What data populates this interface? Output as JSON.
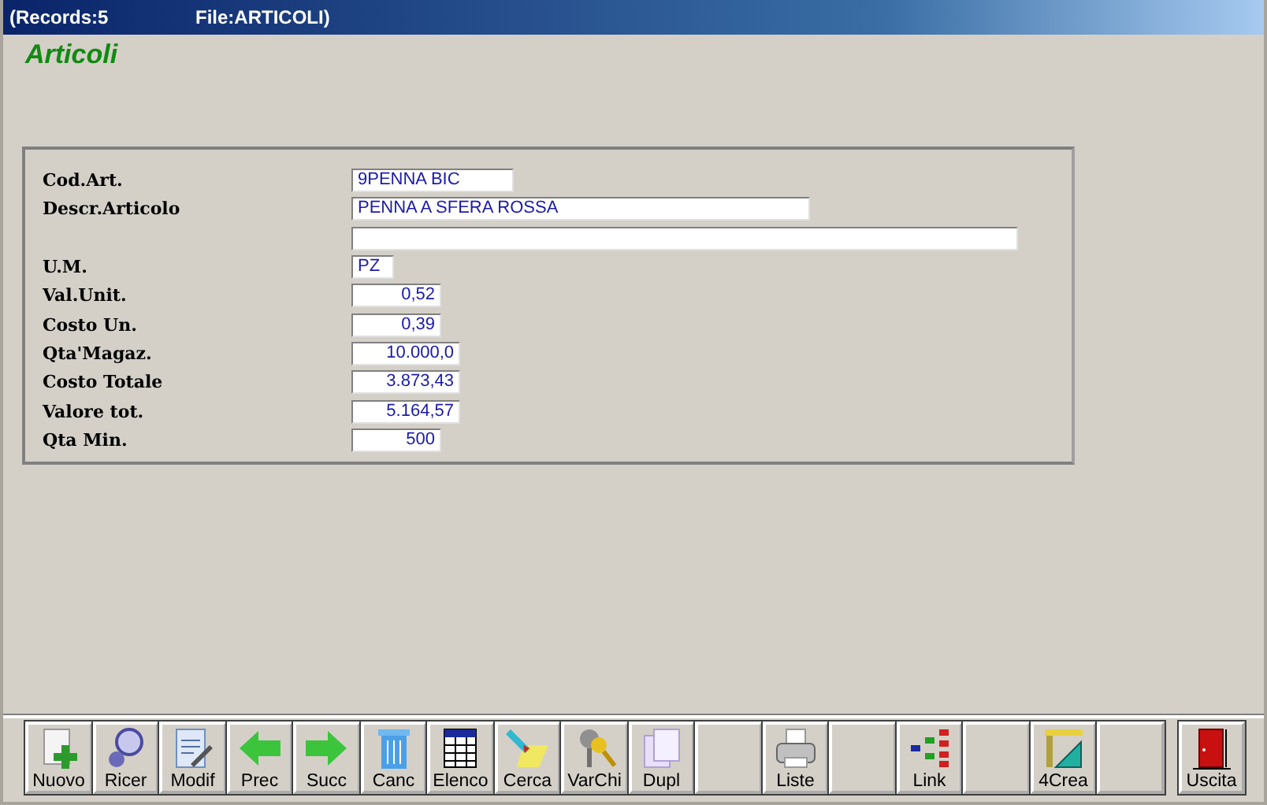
{
  "window": {
    "title": "(Records:5",
    "file": "File:ARTICOLI)"
  },
  "heading": "Articoli",
  "fields": [
    {
      "label": "Cod.Art.",
      "value": "9PENNA BIC",
      "kind": "text"
    },
    {
      "label": "Descr.Articolo",
      "value": "PENNA A SFERA ROSSA",
      "kind": "text"
    },
    {
      "kind": "text"
    },
    {
      "label": "U.M.",
      "value": "PZ",
      "kind": "text"
    },
    {
      "label": "Val.Unit.",
      "value": "0,52",
      "kind": "number"
    },
    {
      "label": "Costo Un.",
      "value": "0,39",
      "kind": "number"
    },
    {
      "label": "Qta'Magaz.",
      "value": "10.000,0",
      "kind": "number"
    },
    {
      "label": "Costo Totale",
      "value": "3.873,43",
      "kind": "number"
    },
    {
      "label": "Valore tot.",
      "value": "5.164,57",
      "kind": "number"
    },
    {
      "label": "Qta Min.",
      "value": "500",
      "kind": "number"
    }
  ],
  "toolbar": [
    {
      "label": "Nuovo",
      "kind": "new"
    },
    {
      "label": "Ricer",
      "kind": "find"
    },
    {
      "label": "Modif",
      "kind": "edit"
    },
    {
      "label": "Prec",
      "kind": "prev"
    },
    {
      "label": "Succ",
      "kind": "next"
    },
    {
      "label": "Canc",
      "kind": "trash"
    },
    {
      "label": "Elenco",
      "kind": "table"
    },
    {
      "label": "Cerca",
      "kind": "marker"
    },
    {
      "label": "VarChi",
      "kind": "keys"
    },
    {
      "label": "Dupl",
      "kind": "copy"
    },
    {
      "kind": "blank"
    },
    {
      "label": "Liste",
      "kind": "print"
    },
    {
      "kind": "blank"
    },
    {
      "label": "Link",
      "kind": "link"
    },
    {
      "kind": "blank"
    },
    {
      "label": "4Crea",
      "kind": "tools"
    },
    {
      "kind": "blank"
    },
    {
      "label": "Uscita",
      "kind": "exit"
    }
  ]
}
